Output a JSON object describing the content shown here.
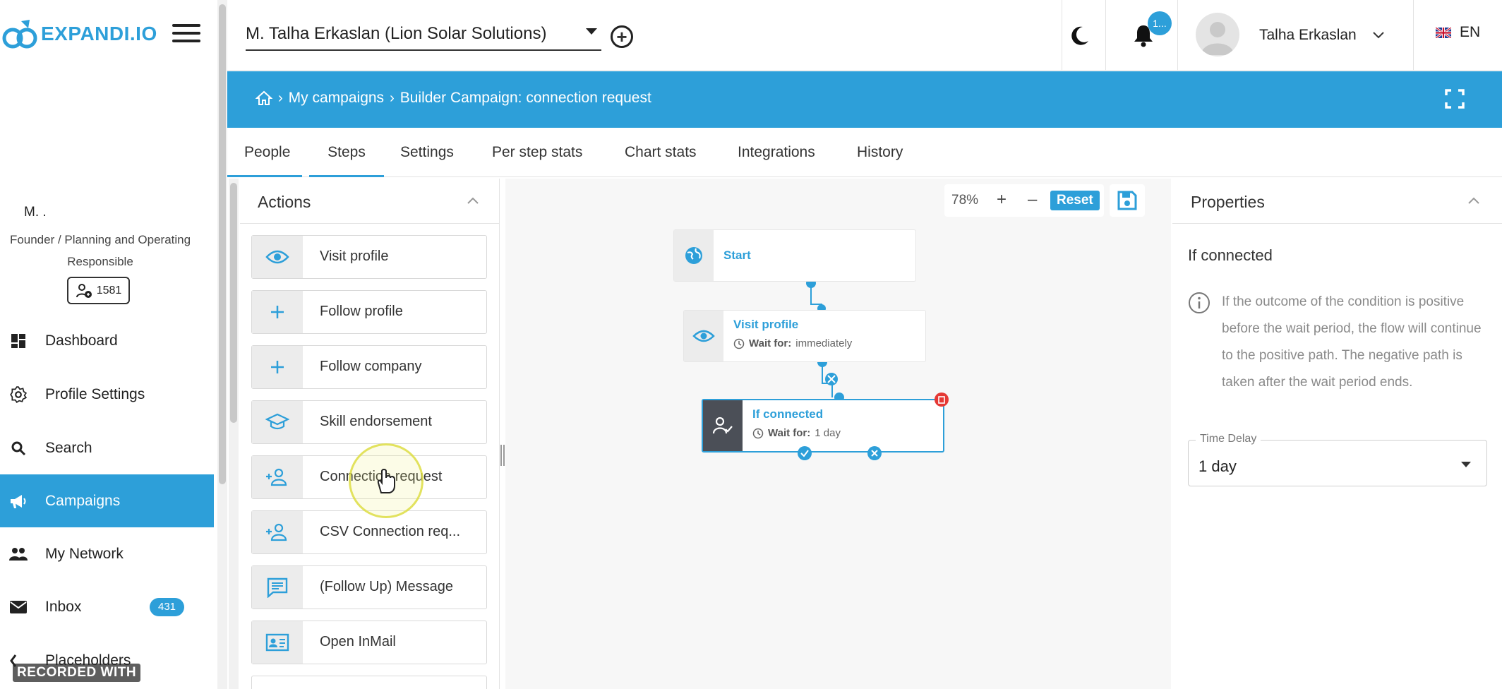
{
  "app": {
    "brand": "EXPANDI.IO",
    "accent": "#2d9fd9"
  },
  "sidebar": {
    "profile_name": "M.                 .",
    "profile_role": "Founder / Planning and Operating Responsible",
    "connections": "1581",
    "items": [
      {
        "label": "Dashboard",
        "icon": "dashboard-icon"
      },
      {
        "label": "Profile Settings",
        "icon": "gear-icon"
      },
      {
        "label": "Search",
        "icon": "search-icon"
      },
      {
        "label": "Campaigns",
        "icon": "megaphone-icon",
        "active": true
      },
      {
        "label": "My Network",
        "icon": "people-icon"
      },
      {
        "label": "Inbox",
        "icon": "mail-icon",
        "badge": "431"
      },
      {
        "label": "Placeholders",
        "icon": "placeholder-icon"
      }
    ],
    "recorded": "RECORDED WITH"
  },
  "header": {
    "account": "M. Talha Erkaslan (Lion Solar Solutions)",
    "notification_count": "1...",
    "user_name": "Talha Erkaslan",
    "language": "EN"
  },
  "breadcrumb": {
    "items": [
      "My campaigns",
      "Builder Campaign: connection request"
    ]
  },
  "tabs": [
    "People",
    "Steps",
    "Settings",
    "Per step stats",
    "Chart stats",
    "Integrations",
    "History"
  ],
  "active_tab": "Steps",
  "actions": {
    "title": "Actions",
    "items": [
      {
        "label": "Visit profile",
        "icon": "eye-icon"
      },
      {
        "label": "Follow profile",
        "icon": "plus-icon"
      },
      {
        "label": "Follow company",
        "icon": "plus-icon"
      },
      {
        "label": "Skill endorsement",
        "icon": "graduation-cap-icon"
      },
      {
        "label": "Connection request",
        "icon": "add-person-icon"
      },
      {
        "label": "CSV Connection req...",
        "icon": "add-person-icon"
      },
      {
        "label": "(Follow Up) Message",
        "icon": "message-icon"
      },
      {
        "label": "Open InMail",
        "icon": "id-card-icon"
      }
    ]
  },
  "canvas": {
    "zoom": "78%",
    "zoom_in": "+",
    "zoom_out": "–",
    "reset": "Reset",
    "nodes": [
      {
        "title": "Start",
        "icon": "globe-icon"
      },
      {
        "title": "Visit profile",
        "wait_label": "Wait for:",
        "wait_value": "immediately",
        "icon": "eye-icon"
      },
      {
        "title": "If connected",
        "wait_label": "Wait for:",
        "wait_value": "1 day",
        "icon": "person-check-icon",
        "selected": true
      }
    ]
  },
  "properties": {
    "title": "Properties",
    "condition": "If connected",
    "info": "If the outcome of the condition is positive before the wait period, the flow will continue to the positive path. The negative path is taken after the wait period ends.",
    "time_delay_label": "Time Delay",
    "time_delay_value": "1 day"
  }
}
